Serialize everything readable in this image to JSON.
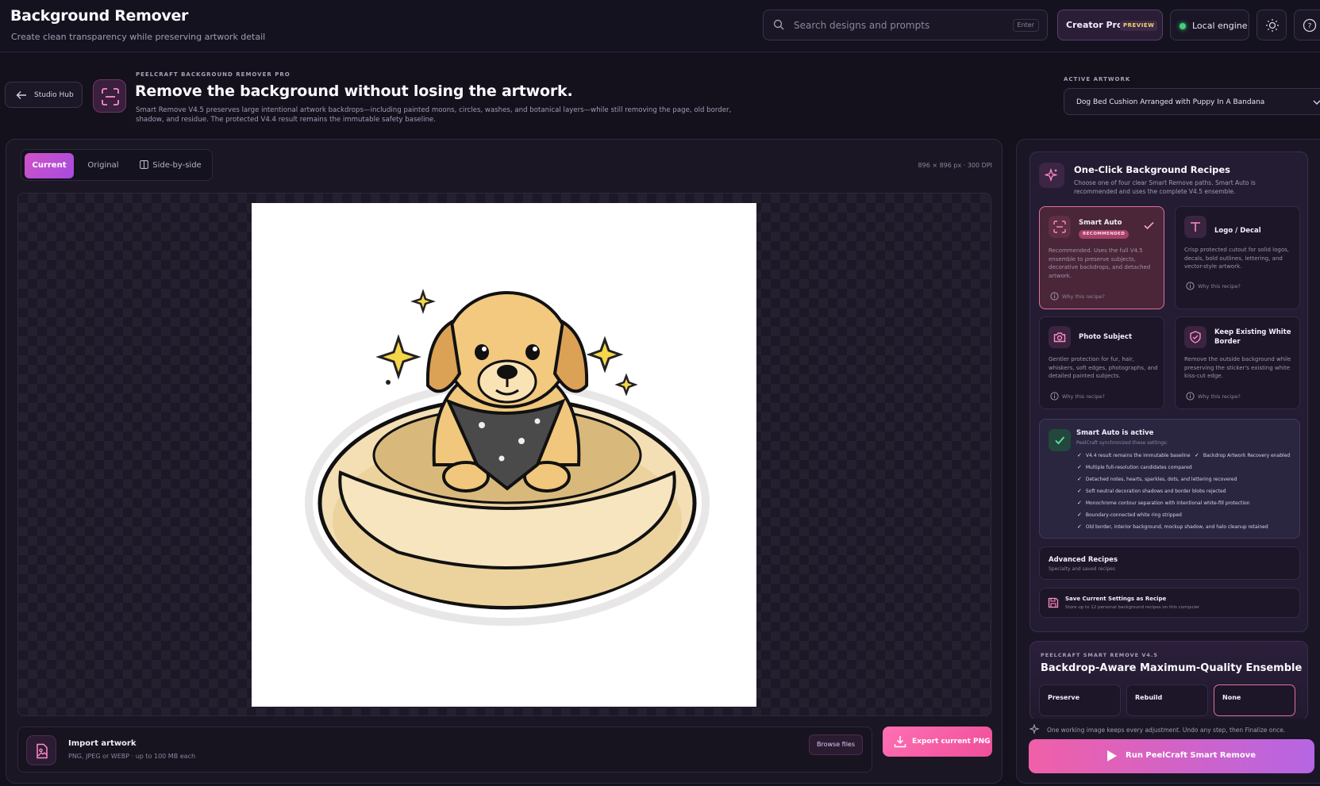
{
  "app": {
    "title": "Background Remover",
    "subtitle": "Create clean transparency while preserving artwork detail"
  },
  "topbar": {
    "search_placeholder": "Search designs and prompts",
    "search_shortcut": "Enter",
    "pro_label": "Creator Pro",
    "pro_tag": "PREVIEW",
    "engine_label": "Local engine",
    "engine_status_color": "#3ed07a",
    "theme_icon": "sun-icon",
    "help_icon": "help-icon"
  },
  "header": {
    "back_label": "Studio Hub",
    "eyebrow": "PEELCRAFT BACKGROUND REMOVER PRO",
    "title": "Remove the background without losing the artwork.",
    "description": "Smart Remove V4.5 preserves large intentional artwork backdrops—including painted moons, circles, washes, and botanical layers—while still removing the page, old border, shadow, and residue. The protected V4.4 result remains the immutable safety baseline.",
    "active_artwork_label": "ACTIVE ARTWORK",
    "active_artwork_value": "Dog Bed Cushion Arranged with Puppy In A Bandana"
  },
  "canvas": {
    "tabs": [
      {
        "label": "Current",
        "active": true
      },
      {
        "label": "Original",
        "active": false
      },
      {
        "label": "Side-by-side",
        "active": false
      }
    ],
    "dimensions": "896 × 896 px · 300 DPI"
  },
  "import": {
    "title": "Import artwork",
    "subtitle": "PNG, JPEG or WEBP · up to 100 MB each",
    "browse_label": "Browse files",
    "export_label": "Export current PNG"
  },
  "recipes": {
    "title": "One-Click Background Recipes",
    "subtitle": "Choose one of four clear Smart Remove paths. Smart Auto is recommended and uses the complete V4.5 ensemble.",
    "why_label": "Why this recipe?",
    "cards": [
      {
        "name": "Smart Auto",
        "badge": "RECOMMENDED",
        "selected": true,
        "icon": "scan-icon",
        "desc": "Recommended. Uses the full V4.5 ensemble to preserve subjects, decorative backdrops, and detached artwork."
      },
      {
        "name": "Logo / Decal",
        "selected": false,
        "icon": "text-icon",
        "desc": "Crisp protected cutout for solid logos, decals, bold outlines, lettering, and vector-style artwork."
      },
      {
        "name": "Photo Subject",
        "selected": false,
        "icon": "camera-icon",
        "desc": "Gentler protection for fur, hair, whiskers, soft edges, photographs, and detailed painted subjects."
      },
      {
        "name": "Keep Existing White Border",
        "selected": false,
        "icon": "shield-icon",
        "desc": "Remove the outside background while preserving the sticker's existing white kiss-cut edge."
      }
    ],
    "active": {
      "title": "Smart Auto is active",
      "subtitle": "PeelCraft synchronized these settings:",
      "items": [
        "V4.4 result remains the immutable baseline",
        "Backdrop Artwork Recovery enabled",
        "Multiple full-resolution candidates compared",
        "Detached notes, hearts, sparkles, dots, and lettering recovered",
        "Soft neutral decoration shadows and border blobs rejected",
        "Monochrome contour separation with intentional white-fill protection",
        "Boundary-connected white ring stripped",
        "Old border, interior background, mockup shadow, and halo cleanup retained"
      ]
    },
    "advanced": {
      "title": "Advanced Recipes",
      "subtitle": "Specialty and saved recipes"
    },
    "save": {
      "title": "Save Current Settings as Recipe",
      "subtitle": "Store up to 12 personal background recipes on this computer"
    }
  },
  "ensemble": {
    "eyebrow": "PEELCRAFT SMART REMOVE V4.5",
    "title": "Backdrop-Aware Maximum-Quality Ensemble",
    "modes": [
      {
        "label": "Preserve",
        "selected": false
      },
      {
        "label": "Rebuild",
        "selected": false
      },
      {
        "label": "None",
        "selected": true
      }
    ]
  },
  "footer": {
    "note": "One working image keeps every adjustment. Undo any step, then Finalize once.",
    "run_label": "Run PeelCraft Smart Remove"
  },
  "colors": {
    "accent_pink": "#ef4f9a",
    "accent_purple": "#a64be0",
    "background": "#14111d"
  }
}
